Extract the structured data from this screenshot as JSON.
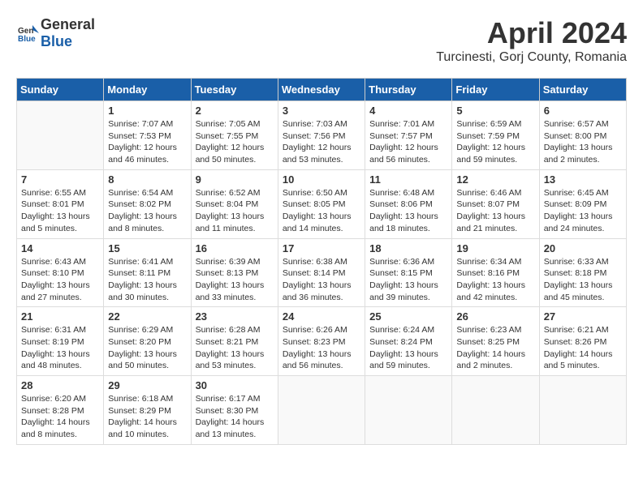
{
  "logo": {
    "general": "General",
    "blue": "Blue"
  },
  "title": "April 2024",
  "subtitle": "Turcinesti, Gorj County, Romania",
  "weekdays": [
    "Sunday",
    "Monday",
    "Tuesday",
    "Wednesday",
    "Thursday",
    "Friday",
    "Saturday"
  ],
  "weeks": [
    [
      {
        "day": "",
        "info": ""
      },
      {
        "day": "1",
        "info": "Sunrise: 7:07 AM\nSunset: 7:53 PM\nDaylight: 12 hours\nand 46 minutes."
      },
      {
        "day": "2",
        "info": "Sunrise: 7:05 AM\nSunset: 7:55 PM\nDaylight: 12 hours\nand 50 minutes."
      },
      {
        "day": "3",
        "info": "Sunrise: 7:03 AM\nSunset: 7:56 PM\nDaylight: 12 hours\nand 53 minutes."
      },
      {
        "day": "4",
        "info": "Sunrise: 7:01 AM\nSunset: 7:57 PM\nDaylight: 12 hours\nand 56 minutes."
      },
      {
        "day": "5",
        "info": "Sunrise: 6:59 AM\nSunset: 7:59 PM\nDaylight: 12 hours\nand 59 minutes."
      },
      {
        "day": "6",
        "info": "Sunrise: 6:57 AM\nSunset: 8:00 PM\nDaylight: 13 hours\nand 2 minutes."
      }
    ],
    [
      {
        "day": "7",
        "info": "Sunrise: 6:55 AM\nSunset: 8:01 PM\nDaylight: 13 hours\nand 5 minutes."
      },
      {
        "day": "8",
        "info": "Sunrise: 6:54 AM\nSunset: 8:02 PM\nDaylight: 13 hours\nand 8 minutes."
      },
      {
        "day": "9",
        "info": "Sunrise: 6:52 AM\nSunset: 8:04 PM\nDaylight: 13 hours\nand 11 minutes."
      },
      {
        "day": "10",
        "info": "Sunrise: 6:50 AM\nSunset: 8:05 PM\nDaylight: 13 hours\nand 14 minutes."
      },
      {
        "day": "11",
        "info": "Sunrise: 6:48 AM\nSunset: 8:06 PM\nDaylight: 13 hours\nand 18 minutes."
      },
      {
        "day": "12",
        "info": "Sunrise: 6:46 AM\nSunset: 8:07 PM\nDaylight: 13 hours\nand 21 minutes."
      },
      {
        "day": "13",
        "info": "Sunrise: 6:45 AM\nSunset: 8:09 PM\nDaylight: 13 hours\nand 24 minutes."
      }
    ],
    [
      {
        "day": "14",
        "info": "Sunrise: 6:43 AM\nSunset: 8:10 PM\nDaylight: 13 hours\nand 27 minutes."
      },
      {
        "day": "15",
        "info": "Sunrise: 6:41 AM\nSunset: 8:11 PM\nDaylight: 13 hours\nand 30 minutes."
      },
      {
        "day": "16",
        "info": "Sunrise: 6:39 AM\nSunset: 8:13 PM\nDaylight: 13 hours\nand 33 minutes."
      },
      {
        "day": "17",
        "info": "Sunrise: 6:38 AM\nSunset: 8:14 PM\nDaylight: 13 hours\nand 36 minutes."
      },
      {
        "day": "18",
        "info": "Sunrise: 6:36 AM\nSunset: 8:15 PM\nDaylight: 13 hours\nand 39 minutes."
      },
      {
        "day": "19",
        "info": "Sunrise: 6:34 AM\nSunset: 8:16 PM\nDaylight: 13 hours\nand 42 minutes."
      },
      {
        "day": "20",
        "info": "Sunrise: 6:33 AM\nSunset: 8:18 PM\nDaylight: 13 hours\nand 45 minutes."
      }
    ],
    [
      {
        "day": "21",
        "info": "Sunrise: 6:31 AM\nSunset: 8:19 PM\nDaylight: 13 hours\nand 48 minutes."
      },
      {
        "day": "22",
        "info": "Sunrise: 6:29 AM\nSunset: 8:20 PM\nDaylight: 13 hours\nand 50 minutes."
      },
      {
        "day": "23",
        "info": "Sunrise: 6:28 AM\nSunset: 8:21 PM\nDaylight: 13 hours\nand 53 minutes."
      },
      {
        "day": "24",
        "info": "Sunrise: 6:26 AM\nSunset: 8:23 PM\nDaylight: 13 hours\nand 56 minutes."
      },
      {
        "day": "25",
        "info": "Sunrise: 6:24 AM\nSunset: 8:24 PM\nDaylight: 13 hours\nand 59 minutes."
      },
      {
        "day": "26",
        "info": "Sunrise: 6:23 AM\nSunset: 8:25 PM\nDaylight: 14 hours\nand 2 minutes."
      },
      {
        "day": "27",
        "info": "Sunrise: 6:21 AM\nSunset: 8:26 PM\nDaylight: 14 hours\nand 5 minutes."
      }
    ],
    [
      {
        "day": "28",
        "info": "Sunrise: 6:20 AM\nSunset: 8:28 PM\nDaylight: 14 hours\nand 8 minutes."
      },
      {
        "day": "29",
        "info": "Sunrise: 6:18 AM\nSunset: 8:29 PM\nDaylight: 14 hours\nand 10 minutes."
      },
      {
        "day": "30",
        "info": "Sunrise: 6:17 AM\nSunset: 8:30 PM\nDaylight: 14 hours\nand 13 minutes."
      },
      {
        "day": "",
        "info": ""
      },
      {
        "day": "",
        "info": ""
      },
      {
        "day": "",
        "info": ""
      },
      {
        "day": "",
        "info": ""
      }
    ]
  ]
}
